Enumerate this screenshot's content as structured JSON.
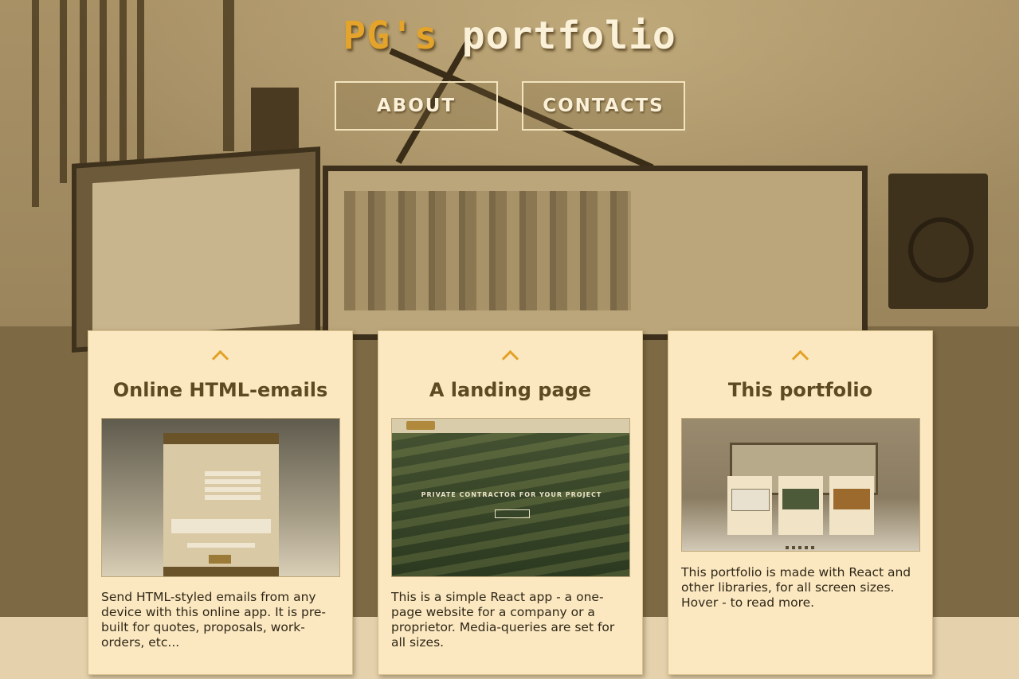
{
  "header": {
    "title_part1": "PG's",
    "title_part2": "portfolio"
  },
  "nav": {
    "about_label": "ABOUT",
    "contacts_label": "CONTACTS"
  },
  "cards": [
    {
      "icon": "chevron-up-icon",
      "title": "Online HTML-emails",
      "description": "Send HTML-styled emails from any device with this online app. It is pre-built for quotes, proposals, work-orders, etc..."
    },
    {
      "icon": "chevron-up-icon",
      "title": "A landing page",
      "description": "This is a simple React app - a one-page website for a company or a proprietor. Media-queries are set for all sizes.",
      "thumbnail_tagline": "PRIVATE CONTRACTOR FOR YOUR PROJECT"
    },
    {
      "icon": "chevron-up-icon",
      "title": "This portfolio",
      "description": "This portfolio is made with React and other libraries, for all screen sizes. Hover - to read more."
    }
  ],
  "colors": {
    "accent": "#e4a32a",
    "card_bg": "#fbe8c1",
    "heading": "#5e4a22"
  }
}
